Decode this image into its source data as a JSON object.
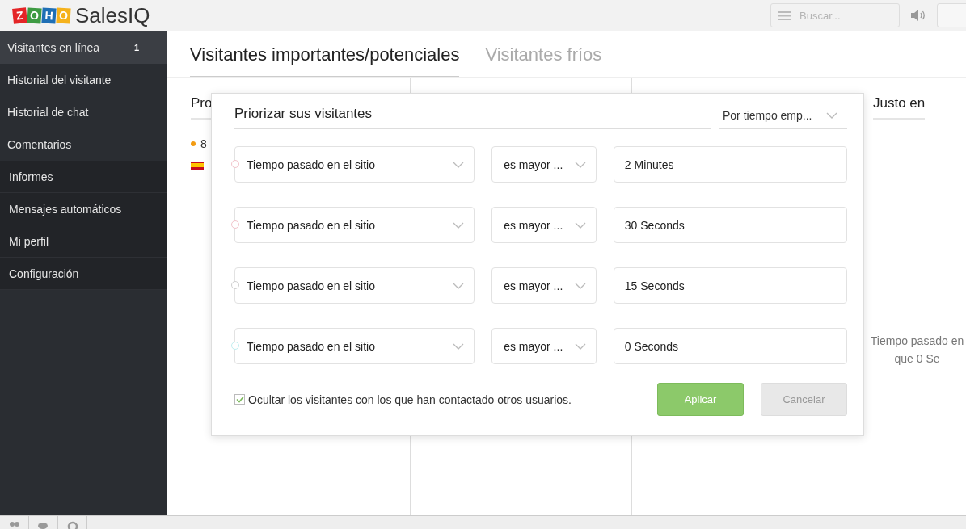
{
  "header": {
    "logo_letters": [
      "Z",
      "O",
      "H",
      "O"
    ],
    "product": "SalesIQ",
    "search": {
      "placeholder": "Buscar..."
    }
  },
  "sidebar": {
    "primary": [
      {
        "label": "Visitantes en línea",
        "badge": "1",
        "selected": true
      },
      {
        "label": "Historial del visitante",
        "selected": false
      },
      {
        "label": "Historial de chat",
        "selected": false
      },
      {
        "label": "Comentarios",
        "selected": false
      }
    ],
    "secondary": [
      {
        "label": "Informes",
        "selected": false
      },
      {
        "label": "Mensajes automáticos",
        "selected": false
      },
      {
        "label": "Mi perfil",
        "selected": false
      },
      {
        "label": "Configuración",
        "selected": false
      }
    ]
  },
  "tabs": [
    {
      "label": "Visitantes importantes/potenciales",
      "selected": true
    },
    {
      "label": "Visitantes fríos",
      "selected": false
    }
  ],
  "columns": [
    {
      "title": "Pro",
      "visitor_count": "8"
    },
    {},
    {},
    {
      "title": "Justo en",
      "note_lines": [
        "Tiempo pasado en",
        "que 0 Se"
      ]
    }
  ],
  "dialog": {
    "title": "Priorizar sus visitantes",
    "sort": "Por tiempo emp...",
    "rules": [
      {
        "field": "Tiempo pasado en el sitio",
        "operator": "es mayor ...",
        "value": "2 Minutes",
        "color": "#f2c4cb"
      },
      {
        "field": "Tiempo pasado en el sitio",
        "operator": "es mayor ...",
        "value": "30 Seconds",
        "color": "#f2c4cb"
      },
      {
        "field": "Tiempo pasado en el sitio",
        "operator": "es mayor ...",
        "value": "15 Seconds",
        "color": "#cfcfcf"
      },
      {
        "field": "Tiempo pasado en el sitio",
        "operator": "es mayor ...",
        "value": "0 Seconds",
        "color": "#bfeef0"
      }
    ],
    "hide_option": {
      "label": "Ocultar los visitantes con los que han contactado otros usuarios.",
      "checked": true
    },
    "buttons": [
      {
        "label": "Aplicar",
        "kind": "primary"
      },
      {
        "label": "Cancelar",
        "kind": "secondary"
      }
    ]
  }
}
